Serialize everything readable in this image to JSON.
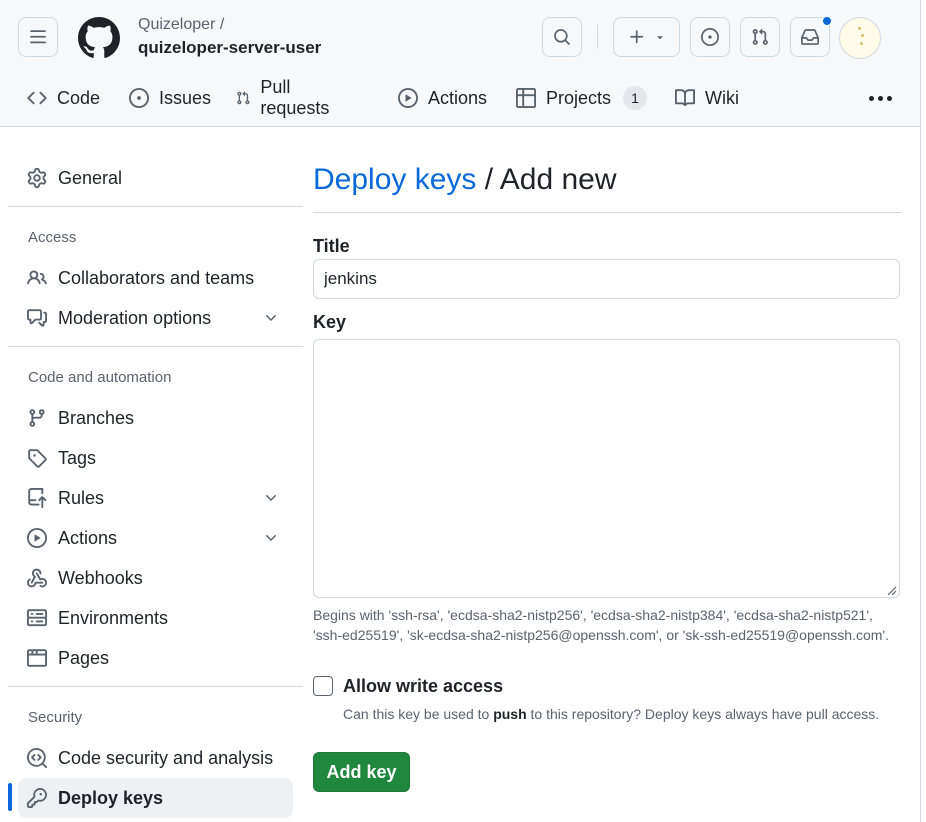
{
  "header": {
    "owner": "Quizeloper /",
    "repo": "quizeloper-server-user",
    "icons": [
      "menu-icon",
      "github-logo-icon",
      "search-icon",
      "plus-icon",
      "issue-icon",
      "pull-request-icon",
      "inbox-icon"
    ],
    "notification_color": "#0969da"
  },
  "tabs": [
    {
      "label": "Code",
      "icon": "code-icon"
    },
    {
      "label": "Issues",
      "icon": "issue-icon"
    },
    {
      "label": "Pull requests",
      "icon": "pull-request-icon"
    },
    {
      "label": "Actions",
      "icon": "play-icon"
    },
    {
      "label": "Projects",
      "icon": "table-icon",
      "count": "1"
    },
    {
      "label": "Wiki",
      "icon": "book-icon"
    }
  ],
  "sidebar": {
    "general": "General",
    "access_heading": "Access",
    "access_items": [
      "Collaborators and teams",
      "Moderation options"
    ],
    "code_heading": "Code and automation",
    "code_items": [
      "Branches",
      "Tags",
      "Rules",
      "Actions",
      "Webhooks",
      "Environments",
      "Pages"
    ],
    "security_heading": "Security",
    "security_items": [
      "Code security and analysis",
      "Deploy keys"
    ]
  },
  "main": {
    "breadcrumb_link": "Deploy keys",
    "breadcrumb_sep": "/",
    "page_title": "Add new",
    "title_label": "Title",
    "title_value": "jenkins",
    "key_label": "Key",
    "key_value": "",
    "key_hint": "Begins with 'ssh-rsa', 'ecdsa-sha2-nistp256', 'ecdsa-sha2-nistp384', 'ecdsa-sha2-nistp521', 'ssh-ed25519', 'sk-ecdsa-sha2-nistp256@openssh.com', or 'sk-ssh-ed25519@openssh.com'.",
    "write_access_label": "Allow write access",
    "write_access_checked": false,
    "write_note_pre": "Can this key be used to",
    "write_note_bold": "push",
    "write_note_post": "to this repository? Deploy keys always have pull access.",
    "add_button": "Add key"
  },
  "colors": {
    "link": "#0969da",
    "primary_button": "#1f883d",
    "header_bg": "#f6f8fa",
    "border": "#d1d9e0"
  }
}
